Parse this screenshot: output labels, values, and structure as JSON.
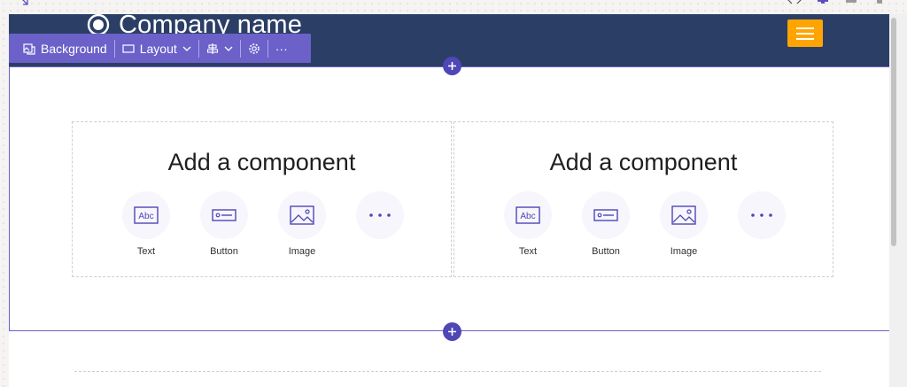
{
  "header": {
    "company_name": "Company name",
    "logo_icon": "circle-logo-icon",
    "menu_icon": "hamburger-menu-icon",
    "bg_color": "#2b3f66",
    "menu_color": "#ffa400"
  },
  "toolbar": {
    "background_label": "Background",
    "layout_label": "Layout",
    "align_icon": "align-icon",
    "settings_icon": "gear-icon",
    "more_label": "···",
    "bg_color": "#6b61c9"
  },
  "columns": [
    {
      "title": "Add a component",
      "options": [
        {
          "label": "Text",
          "icon": "text-abc-icon"
        },
        {
          "label": "Button",
          "icon": "button-icon"
        },
        {
          "label": "Image",
          "icon": "image-icon"
        },
        {
          "label": "",
          "icon": "more-dots-icon"
        }
      ]
    },
    {
      "title": "Add a component",
      "options": [
        {
          "label": "Text",
          "icon": "text-abc-icon"
        },
        {
          "label": "Button",
          "icon": "button-icon"
        },
        {
          "label": "Image",
          "icon": "image-icon"
        },
        {
          "label": "",
          "icon": "more-dots-icon"
        }
      ]
    }
  ],
  "accent_color": "#4e47b5"
}
